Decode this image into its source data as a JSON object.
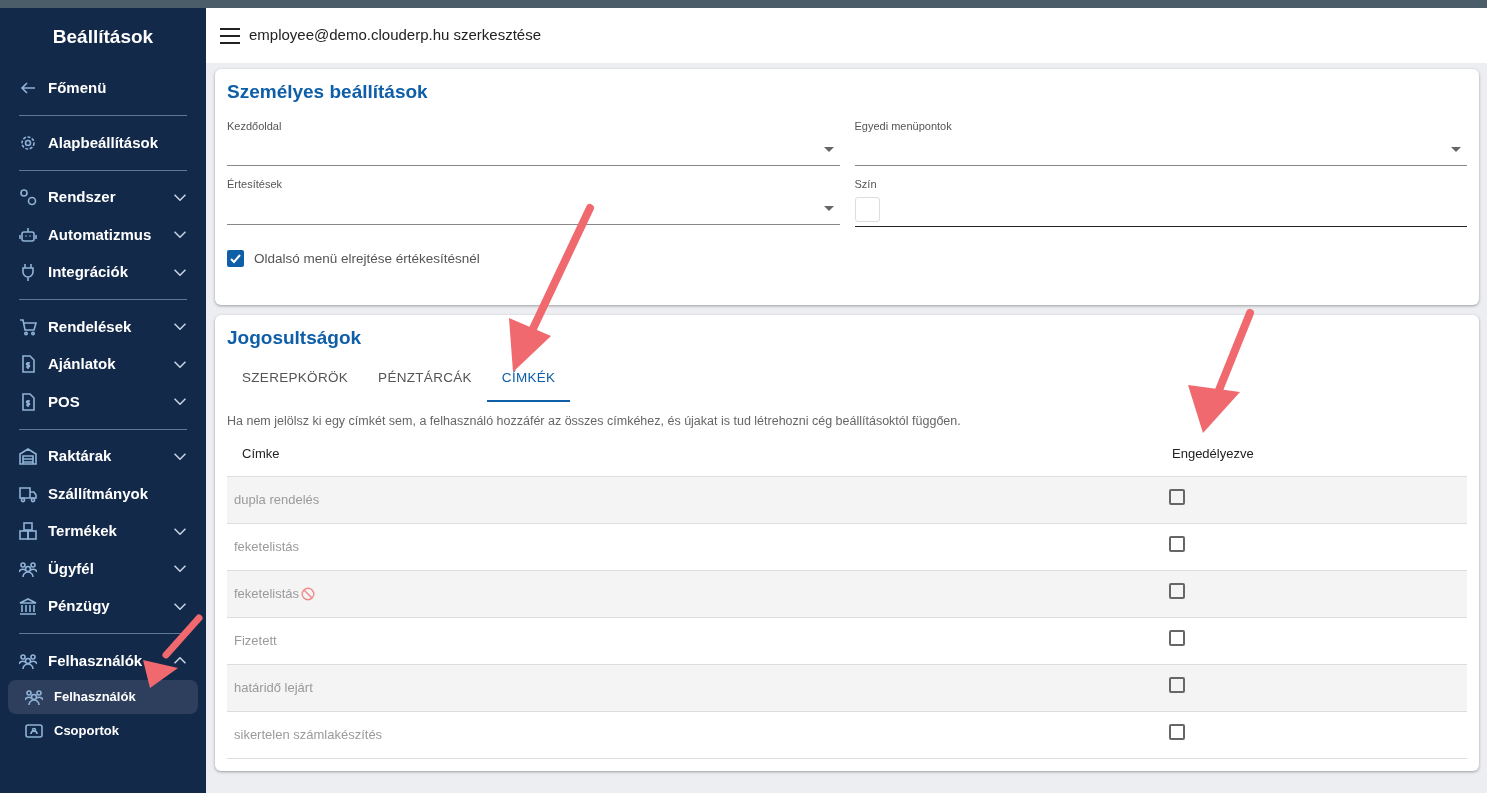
{
  "sidebar": {
    "title": "Beállítások",
    "groups": [
      [
        {
          "label": "Főmenü"
        }
      ],
      [
        {
          "label": "Alapbeállítások"
        }
      ],
      [
        {
          "label": "Rendszer",
          "expanded": false
        },
        {
          "label": "Automatizmus",
          "expanded": false
        },
        {
          "label": "Integrációk",
          "expanded": false
        }
      ],
      [
        {
          "label": "Rendelések",
          "expanded": false
        },
        {
          "label": "Ajánlatok",
          "expanded": false
        },
        {
          "label": "POS",
          "expanded": false
        }
      ],
      [
        {
          "label": "Raktárak",
          "expanded": false
        },
        {
          "label": "Szállítmányok"
        },
        {
          "label": "Termékek",
          "expanded": false
        },
        {
          "label": "Ügyfél",
          "expanded": false
        },
        {
          "label": "Pénzügy",
          "expanded": false
        }
      ],
      [
        {
          "label": "Felhasználók",
          "expanded": true,
          "children": [
            {
              "label": "Felhasználók",
              "selected": true
            },
            {
              "label": "Csoportok",
              "selected": false
            }
          ]
        }
      ]
    ]
  },
  "header": {
    "title": "employee@demo.clouderp.hu szerkesztése"
  },
  "personal": {
    "title": "Személyes beállítások",
    "fields": [
      {
        "kind": "select",
        "label": "Kezdőoldal"
      },
      {
        "kind": "select",
        "label": "Egyedi menüpontok"
      },
      {
        "kind": "select",
        "label": "Értesítések"
      },
      {
        "kind": "color",
        "label": "Szín"
      }
    ],
    "option": {
      "label": "Oldalsó menü elrejtése értékesítésnél",
      "checked": true
    }
  },
  "permissions": {
    "title": "Jogosultságok",
    "tabs": [
      {
        "label": "SZEREPKÖRÖK",
        "selected": false
      },
      {
        "label": "PÉNZTÁRCÁK",
        "selected": false
      },
      {
        "label": "CÍMKÉK",
        "selected": true
      }
    ],
    "hint": "Ha nem jelölsz ki egy címkét sem, a felhasználó hozzáfér az összes címkéhez, és újakat is tud létrehozni cég beállításoktól függően.",
    "table": {
      "columns": [
        "Címke",
        "Engedélyezve"
      ],
      "rows": [
        {
          "label": "dupla rendelés",
          "blocked": false,
          "checked": false
        },
        {
          "label": "feketelistás",
          "blocked": false,
          "checked": false
        },
        {
          "label": "feketelistás",
          "blocked": true,
          "checked": false
        },
        {
          "label": "Fizetett",
          "blocked": false,
          "checked": false
        },
        {
          "label": "határidő lejárt",
          "blocked": false,
          "checked": false
        },
        {
          "label": "sikertelen számlakészítés",
          "blocked": false,
          "checked": false
        }
      ]
    }
  }
}
